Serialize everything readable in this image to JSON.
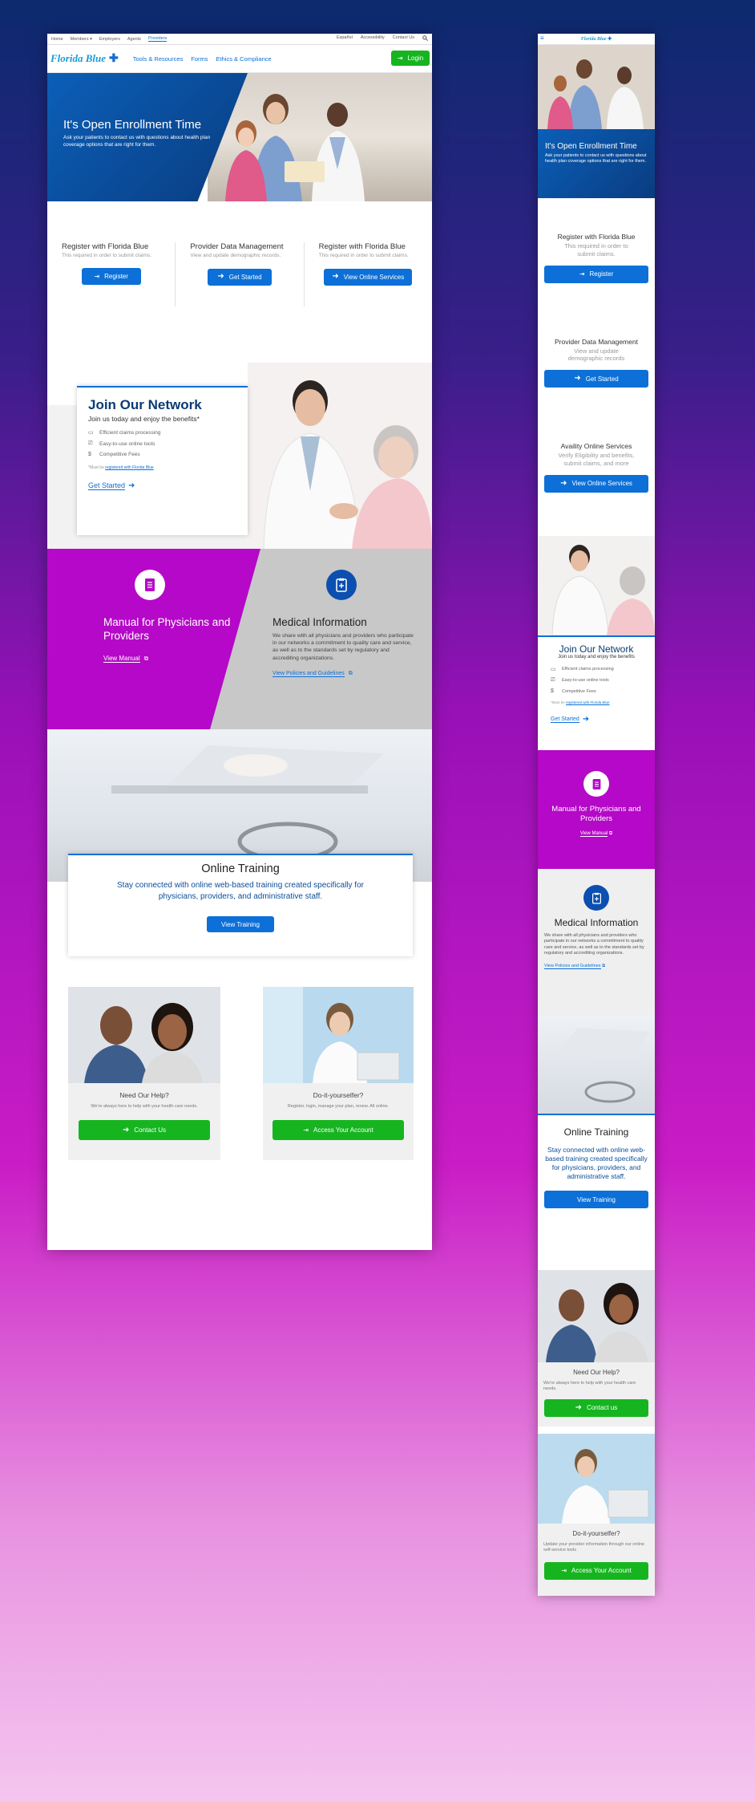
{
  "topbar": {
    "left": [
      "Home",
      "Members",
      "Employers",
      "Agents",
      "Providers"
    ],
    "right": [
      "Español",
      "Accessibility",
      "Contact Us"
    ]
  },
  "brand": {
    "logo": "Florida Blue",
    "primary_color": "#0c70d8",
    "green": "#16b520",
    "purple": "#b508c8"
  },
  "nav": {
    "links": [
      "Tools & Resources",
      "Forms",
      "Ethics & Compliance"
    ],
    "login": "Login"
  },
  "hero": {
    "title": "It's Open Enrollment Time",
    "text": "Ask your patients to contact us with questions about health plan coverage options that are right for them."
  },
  "register": [
    {
      "title": "Register with Florida Blue",
      "text": "This required in order to submit claims.",
      "button": "Register"
    },
    {
      "title": "Provider Data Management",
      "text": "View and update demographic records.",
      "button": "Get Started"
    },
    {
      "title": "Register with Florida Blue",
      "text": "This required in order to submit claims.",
      "button": "View Online Services"
    }
  ],
  "join": {
    "title": "Join Our Network",
    "subtitle": "Join us today and enjoy the benefits*",
    "features": [
      "Efficient claims processing",
      "Easy-to-use online tools",
      "Competitive Fees"
    ],
    "note_prefix": "*Must be",
    "note_link": "registered with Florida Blue",
    "cta": "Get Started"
  },
  "manual": {
    "title": "Manual for Physicians and Providers",
    "link": "View Manual"
  },
  "medical": {
    "title": "Medical Information",
    "text": "We share with all physicians and providers who participate in our networks a commitment to quality care and service, as well as to the standards set by regulatory and accrediting organizations.",
    "link": "View Policies and Guidelines"
  },
  "training": {
    "title": "Online Training",
    "text": "Stay connected with online web-based training created specifically for physicians, providers, and administrative staff.",
    "button": "View Training"
  },
  "help": {
    "title": "Need Our Help?",
    "text": "We're always here to help with your health care needs.",
    "button": "Contact Us"
  },
  "diy": {
    "title": "Do-it-yourselfer?",
    "text": "Register, login, manage your plan, renew. All online.",
    "button": "Access Your Account"
  },
  "mobile": {
    "logo": "Florida Blue",
    "register": [
      {
        "title": "Register with Florida Blue",
        "text": "This required in order to submit claims.",
        "button": "Register"
      },
      {
        "title": "Provider Data Management",
        "text": "View and update demographic records",
        "button": "Get Started"
      },
      {
        "title": "Availity Online Services",
        "text": "Verify Eligibility and benefits, submit claims, and more",
        "button": "View Online Services"
      }
    ],
    "join_subtitle": "Join us today and enjoy the benefits",
    "help_button": "Contact us",
    "help_text": "We're always here to help with your health care needs.",
    "diy_text": "Update your provider information through our online self-service tools"
  }
}
